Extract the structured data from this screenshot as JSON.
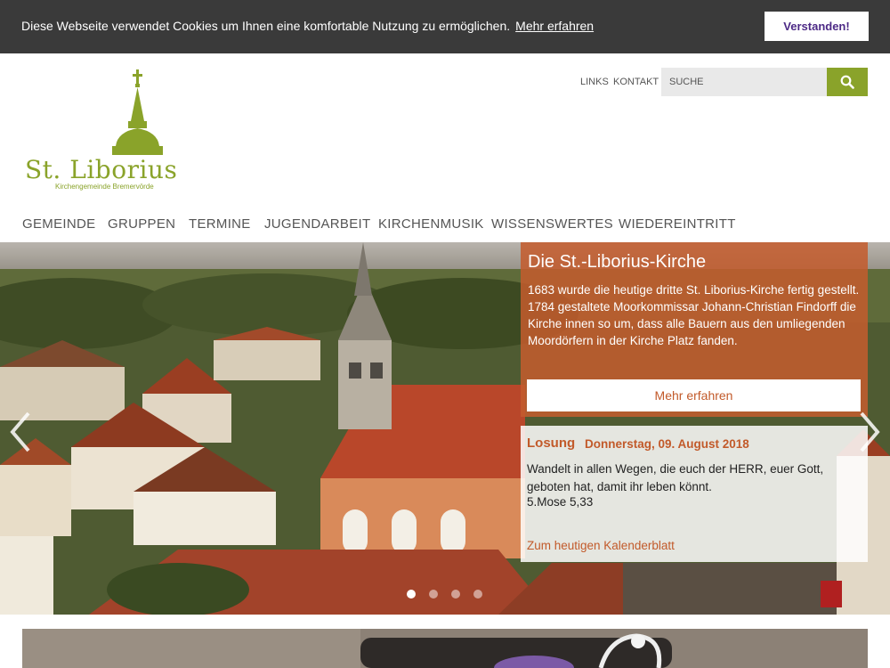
{
  "cookie_bar": {
    "text": "Diese Webseite verwendet Cookies um Ihnen eine komfortable Nutzung zu ermöglichen.",
    "link": "Mehr erfahren",
    "button": "Verstanden!"
  },
  "logo": {
    "name": "St. Liborius",
    "subtitle": "Kirchengemeinde Bremervörde",
    "icon": "church-tower-logo"
  },
  "header": {
    "links": [
      "LINKS",
      "KONTAKT"
    ],
    "search_placeholder": "SUCHE",
    "search_icon": "search-icon"
  },
  "nav": [
    "GEMEINDE",
    "GRUPPEN",
    "TERMINE",
    "JUGENDARBEIT",
    "KIRCHENMUSIK",
    "WISSENSWERTES",
    "WIEDEREINTRITT"
  ],
  "slider": {
    "title": "Die St.-Liborius-Kirche",
    "text": "1683 wurde die heutige dritte St. Liborius-Kirche fertig gestellt. 1784 gestaltete Moorkommissar Johann-Christian Findorff die Kirche innen so um, dass alle Bauern aus den umliegenden Moordörfern in der Kirche Platz fanden.",
    "button": "Mehr erfahren",
    "slide_count": 4,
    "active_slide": 1
  },
  "losung": {
    "label": "Losung",
    "date": "Donnerstag, 09. August 2018",
    "verse": "Wandelt in allen Wegen, die euch der HERR, euer Gott, geboten hat, damit ihr leben könnt.",
    "reference": "5.Mose 5,33",
    "link": "Zum heutigen Kalenderblatt"
  },
  "colors": {
    "accent_green": "#8aa32a",
    "accent_orange": "#c25a2a",
    "cookie_bg": "#3a3a3a",
    "cookie_button_text": "#4d2a86"
  }
}
